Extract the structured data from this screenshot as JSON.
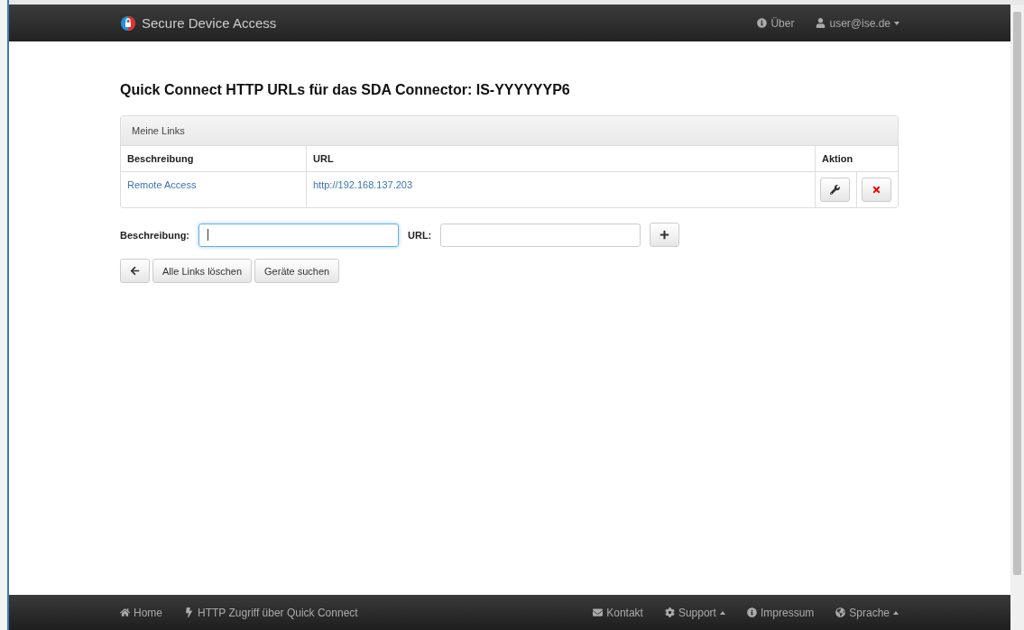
{
  "navbar": {
    "brand": "Secure Device Access",
    "items": [
      {
        "label": "Über",
        "dropdown": false
      },
      {
        "label": "user@ise.de",
        "dropdown": true
      }
    ]
  },
  "title": "Quick Connect HTTP URLs für das SDA Connector: IS-YYYYYYP6",
  "panel": {
    "heading": "Meine Links",
    "columns": [
      "Beschreibung",
      "URL",
      "Aktion"
    ],
    "rows": [
      {
        "description": "Remote Access",
        "url": "http://192.168.137.203"
      }
    ]
  },
  "form": {
    "fields": [
      {
        "label": "Beschreibung:",
        "focused": true
      },
      {
        "label": "URL:",
        "focused": false
      }
    ]
  },
  "buttons": [
    {
      "kind": "icon"
    },
    {
      "kind": "text",
      "label": "Alle Links löschen"
    },
    {
      "kind": "text",
      "label": "Geräte suchen"
    }
  ],
  "footer": {
    "left": [
      {
        "label": "Home",
        "dropdown": false
      },
      {
        "label": "HTTP Zugriff über Quick Connect",
        "dropdown": false
      }
    ],
    "right": [
      {
        "label": "Kontakt",
        "dropdown": false
      },
      {
        "label": "Support",
        "dropdown": true
      },
      {
        "label": "Impressum",
        "dropdown": false
      },
      {
        "label": "Sprache",
        "dropdown": true
      }
    ]
  }
}
